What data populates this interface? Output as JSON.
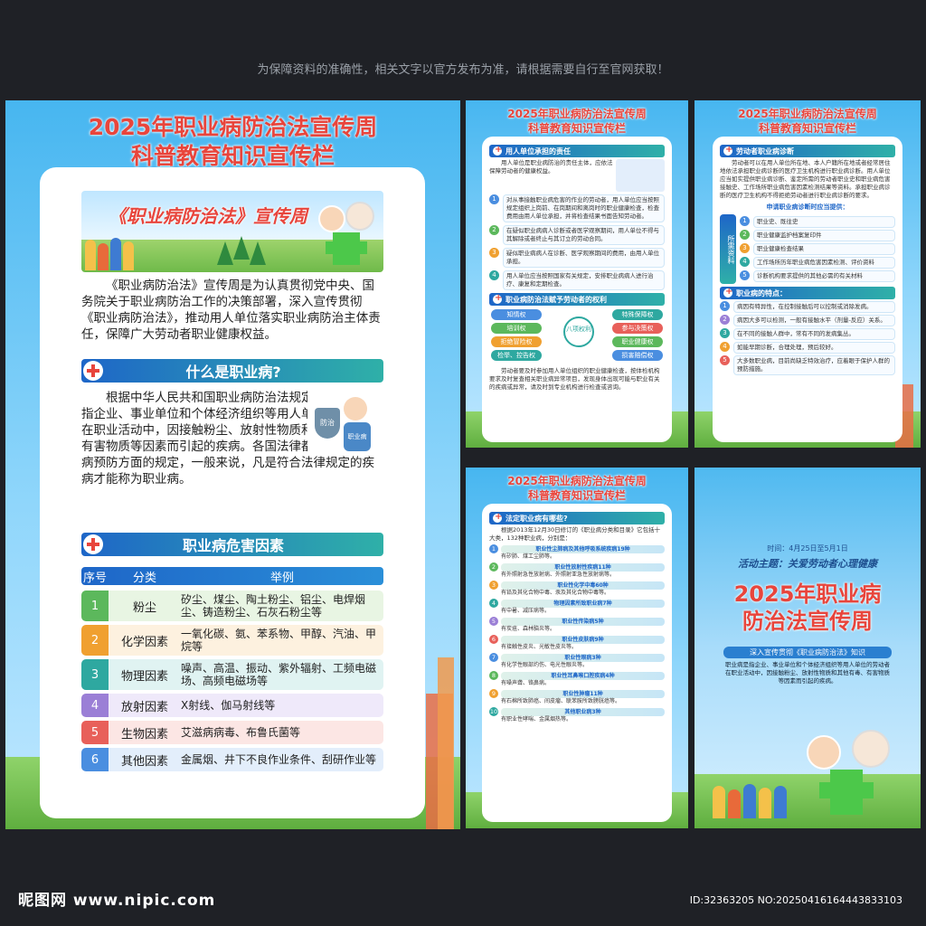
{
  "notice": "为保障资料的准确性，相关文字以官方发布为准，请根据需要自行至官网获取！",
  "footer": {
    "site": "昵图网 www.nipic.com",
    "id": "ID:32363205 NO:20250416164443833103"
  },
  "main": {
    "title1": "2025年职业病防治法宣传周",
    "title2": "科普教育知识宣传栏",
    "banner": "《职业病防治法》宣传周",
    "intro": "《职业病防治法》宣传周是为认真贯彻党中央、国务院关于职业病防治工作的决策部署，深入宣传贯彻《职业病防治法》，推动用人单位落实职业病防治主体责任，保障广大劳动者职业健康权益。",
    "sec1": "什么是职业病?",
    "def": "根据中华人民共和国职业病防治法规定：职业病是指企业、事业单位和个体经济组织等用人单位的劳动者在职业活动中，因接触粉尘、放射性物质和其他有毒、有害物质等因素而引起的疾病。各国法律都有对于职业病预防方面的规定，一般来说，凡是符合法律规定的疾病才能称为职业病。",
    "illus_label1": "防治",
    "illus_label2": "职业病",
    "sec2": "职业病危害因素",
    "table_head": [
      "序号",
      "分类",
      "举例"
    ],
    "rows": [
      {
        "n": "1",
        "cat": "粉尘",
        "ex": "矽尘、煤尘、陶土粉尘、铝尘、电焊烟尘、铸造粉尘、石灰石粉尘等",
        "color": "#5cb85c",
        "bg": "#e8f5e3"
      },
      {
        "n": "2",
        "cat": "化学因素",
        "ex": "一氧化碳、氨、苯系物、甲醇、汽油、甲烷等",
        "color": "#f0a030",
        "bg": "#fdf1df"
      },
      {
        "n": "3",
        "cat": "物理因素",
        "ex": "噪声、高温、振动、紫外辐射、工频电磁场、高频电磁场等",
        "color": "#2ea8a0",
        "bg": "#e0f3f2"
      },
      {
        "n": "4",
        "cat": "放射因素",
        "ex": "X射线、伽马射线等",
        "color": "#9b7fd6",
        "bg": "#efe9fa"
      },
      {
        "n": "5",
        "cat": "生物因素",
        "ex": "艾滋病病毒、布鲁氏菌等",
        "color": "#e8605a",
        "bg": "#fce6e4"
      },
      {
        "n": "6",
        "cat": "其他因素",
        "ex": "金属烟、井下不良作业条件、刮研作业等",
        "color": "#4a8ee0",
        "bg": "#e3eefb"
      }
    ]
  },
  "p2": {
    "title1": "2025年职业病防治法宣传周",
    "title2": "科普教育知识宣传栏",
    "sec1": "用人单位承担的责任",
    "intro": "用人单位是职业病防治的责任主体，应依法保障劳动者的健康权益。",
    "items": [
      "对从事接触职业病危害的作业的劳动者，用人单位应当按照规定组织上岗前、在岗期间和离岗时的职业健康检查，检查费用由用人单位承担，并将检查结果书面告知劳动者。",
      "在疑似职业病病人诊断或者医学观察期间，用人单位不得与其解除或者终止与其订立的劳动合同。",
      "疑似职业病病人在诊断、医学观察期间的费用，由用人单位承担。",
      "用人单位应当按照国家有关规定，安排职业病病人进行治疗、康复和定期检查。"
    ],
    "sec2": "职业病防治法赋予劳动者的权利",
    "rights_left": [
      "知情权",
      "培训权",
      "拒绝冒险权",
      "检举、控告权"
    ],
    "rights_center": "八项权利",
    "rights_right": [
      "特殊保障权",
      "参与决策权",
      "职业健康权",
      "损害赔偿权"
    ],
    "closing": "劳动者要及时参加用人单位组织的职业健康检查，按体检机构要求及时复查相关职业病异常项目，发现身体出现可能与职业有关的疾病或异常，请及时到专业机构进行检查或咨询。"
  },
  "p3": {
    "title1": "2025年职业病防治法宣传周",
    "title2": "科普教育知识宣传栏",
    "sec1": "劳动者职业病诊断",
    "intro": "劳动者可以在用人单位所在地、本人户籍所在地或者经常居住地依法承担职业病诊断的医疗卫生机构进行职业病诊断。用人单位应当如实提供职业病诊断、鉴定所需的劳动者职业史和职业病危害接触史、工作场所职业病危害因素检测结果等资料。承担职业病诊断的医疗卫生机构不得拒绝劳动者进行职业病诊断的要求。",
    "need": "申请职业病诊断时应当提供：",
    "side_label": "所需资料",
    "docs": [
      "职业史、既往史",
      "职业健康监护档案复印件",
      "职业健康检查结果",
      "工作场所历年职业病危害因素检测、评价资料",
      "诊断机构要求提供的其他必需的有关材料"
    ],
    "sec2": "职业病的特点：",
    "features": [
      "病因有特异性，在控制接触后可以控制或消除发病。",
      "病因大多可以检测，一般有接触水平（剂量-反应）关系。",
      "在不同的接触人群中，常有不同的发病集丛。",
      "如能早期诊断，合理处理，预后较好。",
      "大多数职业病，目前尚缺乏特效治疗，应着眼于保护人群的预防措施。"
    ]
  },
  "p4": {
    "title1": "2025年职业病防治法宣传周",
    "title2": "科普教育知识宣传栏",
    "sec1": "法定职业病有哪些?",
    "intro": "根据2013年12月30日修订的《职业病分类和目录》它包括十大类，132种职业病，分别是：",
    "cats": [
      {
        "h": "职业性尘肺病及其他呼吸系统疾病19种",
        "d": "有矽肺、煤工尘肺等。"
      },
      {
        "h": "职业性放射性疾病11种",
        "d": "有外照射急性放射病、外照射亚急性放射病等。"
      },
      {
        "h": "职业性化学中毒60种",
        "d": "有铅及其化合物中毒、汞及其化合物中毒等。"
      },
      {
        "h": "物理因素所致职业病7种",
        "d": "有中暑、减压病等。"
      },
      {
        "h": "职业性传染病5种",
        "d": "有炭疽、森林脑炎等。"
      },
      {
        "h": "职业性皮肤病9种",
        "d": "有接触性皮炎、光敏性皮炎等。"
      },
      {
        "h": "职业性眼病3种",
        "d": "有化学性眼部灼伤、电光性眼炎等。"
      },
      {
        "h": "职业性耳鼻喉口腔疾病4种",
        "d": "有噪声聋、铬鼻病。"
      },
      {
        "h": "职业性肿瘤11种",
        "d": "有石棉所致肺癌、间皮瘤、联苯胺所致膀胱癌等。"
      },
      {
        "h": "其他职业病3种",
        "d": "有职业性哮喘、金属烟热等。"
      }
    ],
    "num_colors": [
      "#4a8ee0",
      "#5cb85c",
      "#f0a030",
      "#2ea8a0",
      "#9b7fd6",
      "#e8605a",
      "#4a8ee0",
      "#5cb85c",
      "#f0a030",
      "#2ea8a0"
    ]
  },
  "p5": {
    "time": "时间：4月25日至5月1日",
    "theme": "活动主题：关爱劳动者心理健康",
    "title1": "2025年职业病",
    "title2": "防治法宣传周",
    "sub": "深入宣传贯彻《职业病防治法》知识",
    "body": "职业病是指企业、事业单位和个体经济组织等用人单位的劳动者在职业活动中，因接触粉尘、放射性物质和其他有毒、有害物质等因素而引起的疾病。"
  }
}
